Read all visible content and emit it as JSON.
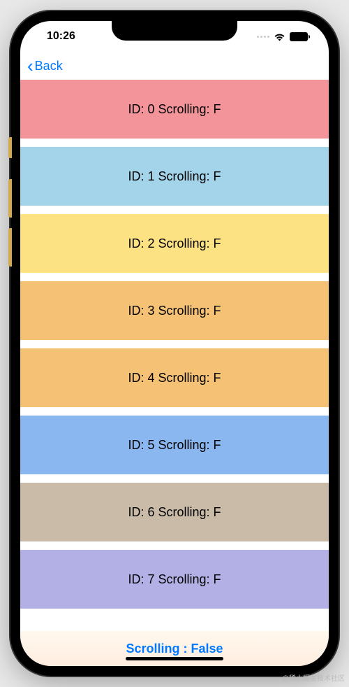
{
  "status_bar": {
    "time": "10:26"
  },
  "nav": {
    "back_label": "Back"
  },
  "rows": [
    {
      "text": "ID: 0 Scrolling: F"
    },
    {
      "text": "ID: 1 Scrolling: F"
    },
    {
      "text": "ID: 2 Scrolling: F"
    },
    {
      "text": "ID: 3 Scrolling: F"
    },
    {
      "text": "ID: 4 Scrolling: F"
    },
    {
      "text": "ID: 5 Scrolling: F"
    },
    {
      "text": "ID: 6 Scrolling: F"
    },
    {
      "text": "ID: 7 Scrolling: F"
    }
  ],
  "footer": {
    "status_text": "Scrolling : False"
  },
  "watermark": "@稀土掘金技术社区"
}
